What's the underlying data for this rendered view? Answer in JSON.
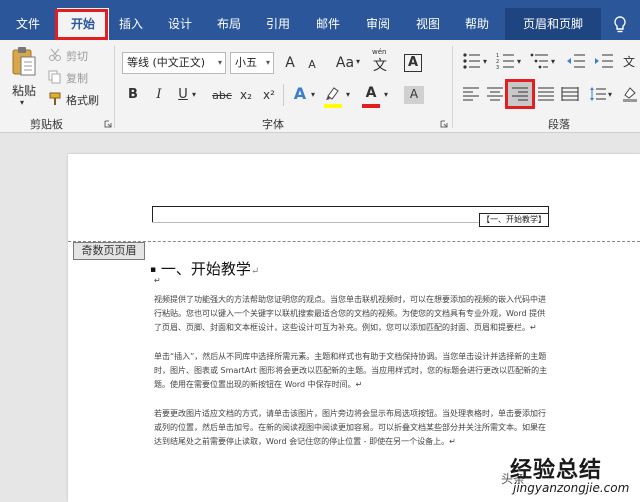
{
  "tabs": [
    {
      "label": "文件"
    },
    {
      "label": "开始"
    },
    {
      "label": "插入"
    },
    {
      "label": "设计"
    },
    {
      "label": "布局"
    },
    {
      "label": "引用"
    },
    {
      "label": "邮件"
    },
    {
      "label": "审阅"
    },
    {
      "label": "视图"
    },
    {
      "label": "帮助"
    },
    {
      "label": "页眉和页脚"
    }
  ],
  "clipboard": {
    "paste": "粘贴",
    "cut": "剪切",
    "copy": "复制",
    "format_painter": "格式刷",
    "group": "剪贴板"
  },
  "font": {
    "name": "等线 (中文正文)",
    "size": "小五",
    "grow": "A",
    "shrink": "A",
    "case": "Aa",
    "phonetic_top": "wén",
    "phonetic_char": "文",
    "clear": "A",
    "bold": "B",
    "italic": "I",
    "underline": "U",
    "strike": "abc",
    "subscript": "x₂",
    "superscript": "x²",
    "text_effects": "A",
    "font_color": "A",
    "char_border": "A",
    "group": "字体"
  },
  "paragraph": {
    "group": "段落"
  },
  "document": {
    "header_box": "【一、开始教学】",
    "header_tag": "奇数页页眉",
    "heading": "一、开始教学",
    "paragraph_mark": "↵",
    "paragraphs": [
      "视频提供了功能强大的方法帮助您证明您的观点。当您单击联机视频时，可以在想要添加的视频的嵌入代码中进行粘贴。您也可以键入一个关键字以联机搜索最适合您的文档的视频。为使您的文档具有专业外观，Word 提供了页眉、页脚、封面和文本框设计，这些设计可互为补充。例如，您可以添加匹配的封面、页眉和提要栏。↵",
      "单击“插入”，然后从不同库中选择所需元素。主题和样式也有助于文档保持协调。当您单击设计并选择新的主题时，图片、图表或 SmartArt 图形将会更改以匹配新的主题。当应用样式时，您的标题会进行更改以匹配新的主题。使用在需要位置出现的新按钮在 Word 中保存时间。↵",
      "若要更改图片适应文档的方式，请单击该图片，图片旁边将会显示布局选项按钮。当处理表格时，单击要添加行或列的位置，然后单击加号。在新的阅读视图中阅读更加容易。可以折叠文档某些部分并关注所需文本。如果在达到结尾处之前需要停止读取，Word 会记住您的停止位置 - 即使在另一个设备上。↵"
    ]
  },
  "watermark": {
    "left": "头条",
    "main": "经验总结",
    "url": "jingyanzongjie.com"
  },
  "colors": {
    "ribbon_blue": "#2b579a",
    "highlight_red": "#e02020",
    "text_effect_blue": "#3c7fd0",
    "highlight_yellow": "#ffff00",
    "font_red": "#e02020"
  }
}
